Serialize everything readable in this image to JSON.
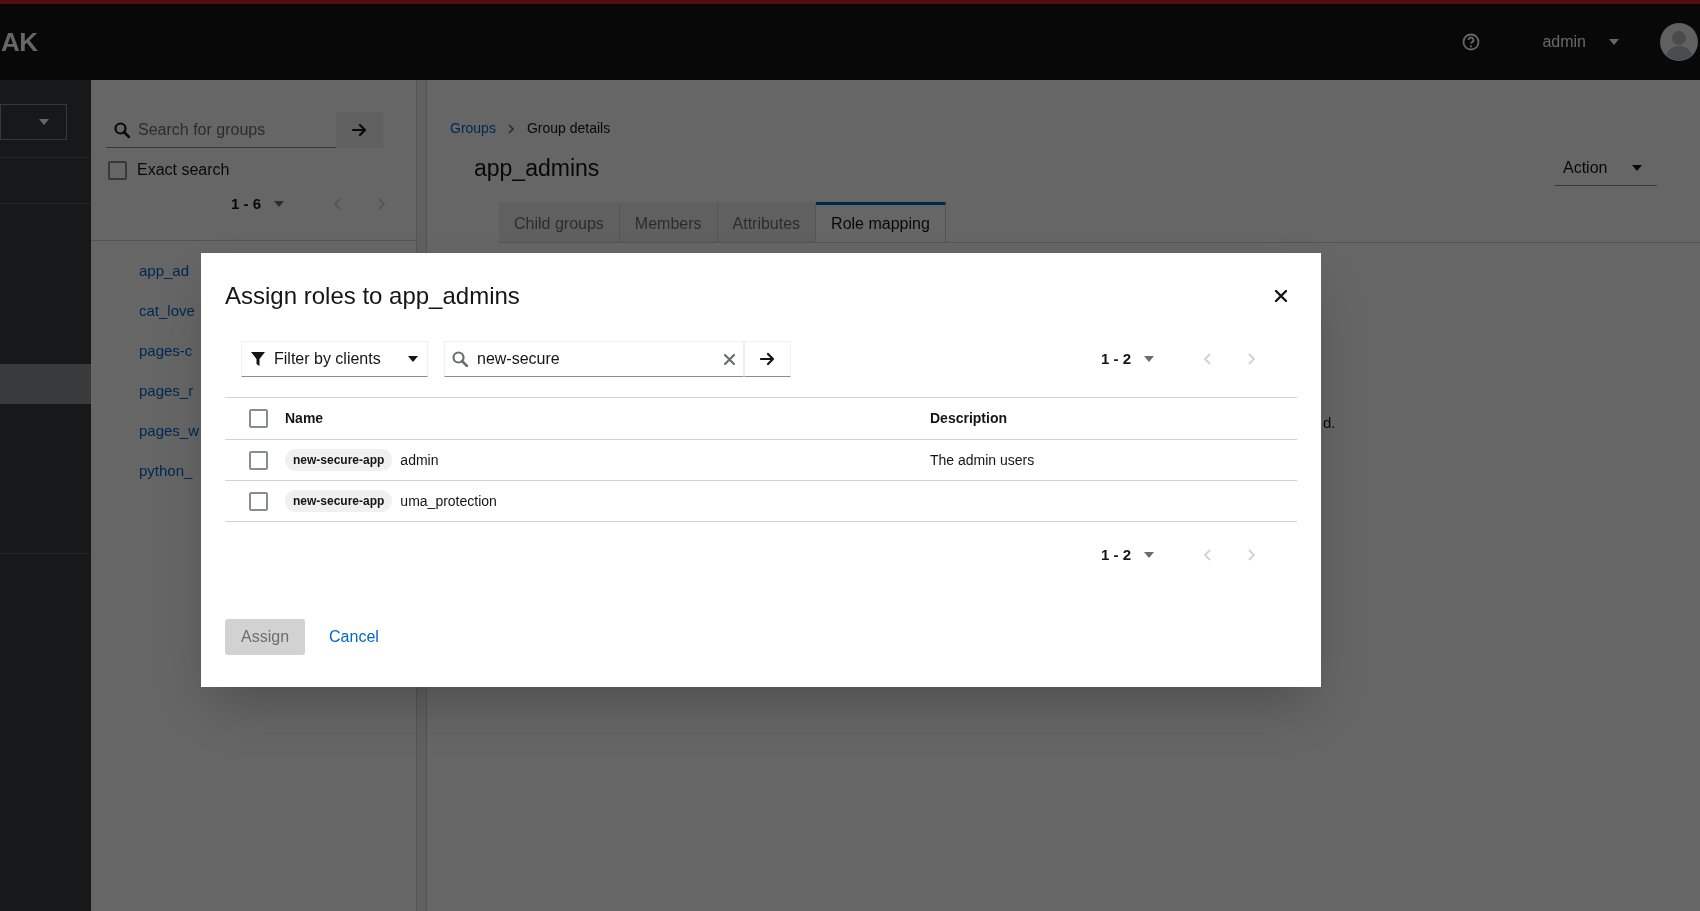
{
  "header": {
    "logo_text": "AK",
    "user": "admin"
  },
  "sidebar": {
    "items": [
      {
        "selected": false
      },
      {
        "selected": false
      },
      {
        "selected": false
      },
      {
        "selected": true
      },
      {
        "selected": false
      },
      {
        "selected": false
      },
      {
        "selected": false
      }
    ]
  },
  "groups_panel": {
    "search": {
      "placeholder": "Search for groups"
    },
    "exact_search": {
      "label": "Exact search",
      "checked": false
    },
    "pagination": "1 - 6",
    "groups": [
      "app_ad",
      "cat_love",
      "pages-c",
      "pages_r",
      "pages_w",
      "python_"
    ]
  },
  "main": {
    "breadcrumb": [
      "Groups",
      "Group details"
    ],
    "title": "app_admins",
    "action": "Action",
    "tabs": [
      {
        "label": "Child groups",
        "selected": false
      },
      {
        "label": "Members",
        "selected": false
      },
      {
        "label": "Attributes",
        "selected": false
      },
      {
        "label": "Role mapping",
        "selected": true
      }
    ],
    "hidden_text": "d."
  },
  "modal": {
    "title": "Assign roles to app_admins",
    "filter": "Filter by clients",
    "search": {
      "value": "new-secure"
    },
    "pagination": "1 - 2",
    "select_all": {
      "checked": false
    },
    "columns": [
      "Name",
      "Description"
    ],
    "rows": [
      {
        "checked": false,
        "client": "new-secure-app",
        "role": "admin",
        "description": "The admin users"
      },
      {
        "checked": false,
        "client": "new-secure-app",
        "role": "uma_protection"
      }
    ],
    "bottom_pagination": "1 - 2",
    "assign": {
      "label": "Assign",
      "disabled": true
    },
    "cancel": "Cancel"
  }
}
